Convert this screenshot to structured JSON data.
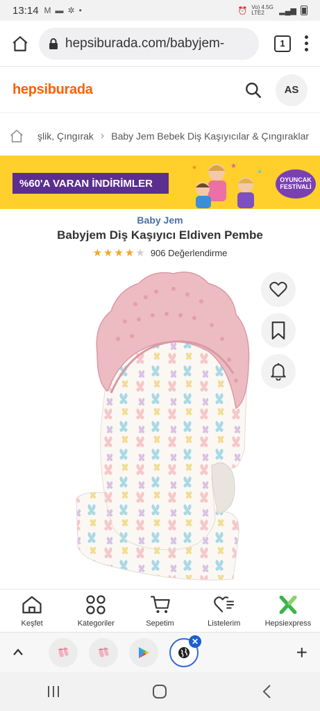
{
  "status_bar": {
    "time": "13:14",
    "network": "Vo) 4.5G LTE2"
  },
  "browser": {
    "url": "hepsiburada.com/babyjem-",
    "tab_count": "1"
  },
  "site": {
    "logo": "hepsiburada",
    "avatar_initials": "AS"
  },
  "breadcrumb": {
    "items": [
      "şlik, Çıngırak",
      "Baby Jem Bebek Diş Kaşıyıcılar & Çıngıraklar"
    ]
  },
  "banner": {
    "promo": "%60'A VARAN İNDİRİMLER",
    "festival": "OYUNCAK FESTİVALİ"
  },
  "product": {
    "brand": "Baby Jem",
    "title": "Babyjem Diş Kaşıyıcı Eldiven Pembe",
    "rating": 4,
    "rating_max": 5,
    "review_count": "906 Değerlendirme"
  },
  "bottom_nav": {
    "items": [
      {
        "label": "Keşfet",
        "icon": "home-icon"
      },
      {
        "label": "Kategoriler",
        "icon": "categories-icon"
      },
      {
        "label": "Sepetim",
        "icon": "cart-icon"
      },
      {
        "label": "Listelerim",
        "icon": "heart-list-icon"
      },
      {
        "label": "Hepsiexpress",
        "icon": "hepsiexpress-icon"
      }
    ]
  },
  "colors": {
    "brand_orange": "#ff6000",
    "banner_yellow": "#ffd02c",
    "promo_purple": "#5b2e8f",
    "star": "#f5a623",
    "brand_link": "#4a6fa5",
    "hepsiexpress_green": "#3ab54a"
  }
}
